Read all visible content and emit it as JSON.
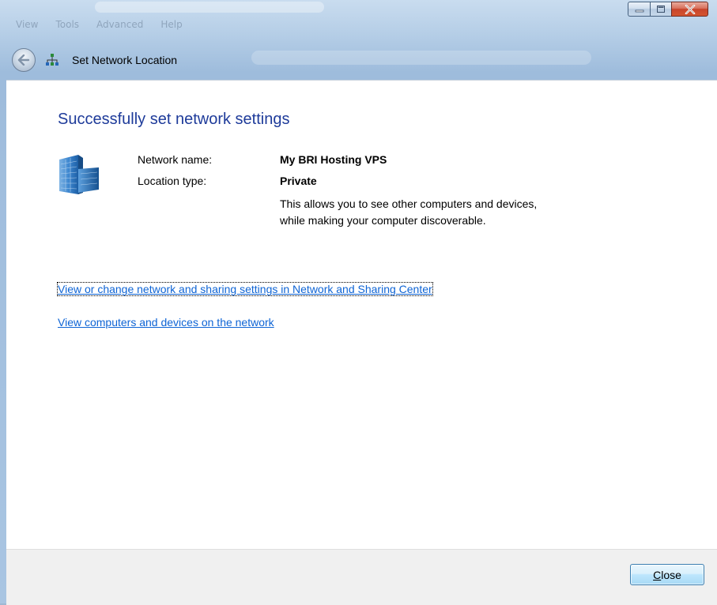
{
  "window": {
    "title": "Set Network Location",
    "background_menu": [
      "View",
      "Tools",
      "Advanced",
      "Help"
    ],
    "accent_color": "#1e3b9a",
    "link_color": "#0e64d5"
  },
  "nav": {
    "back_icon": "back-arrow-icon",
    "app_icon": "network-icon"
  },
  "content": {
    "heading": "Successfully set network settings",
    "network_name_label": "Network name:",
    "network_name_value": "My BRI Hosting VPS",
    "location_type_label": "Location type:",
    "location_type_value": "Private",
    "location_description": "This allows you to see other computers and devices, while making your computer discoverable.",
    "link_sharing_center": "View or change network and sharing settings in Network and Sharing Center",
    "link_view_computers": "View computers and devices on the network"
  },
  "footer": {
    "close_label": "Close"
  }
}
